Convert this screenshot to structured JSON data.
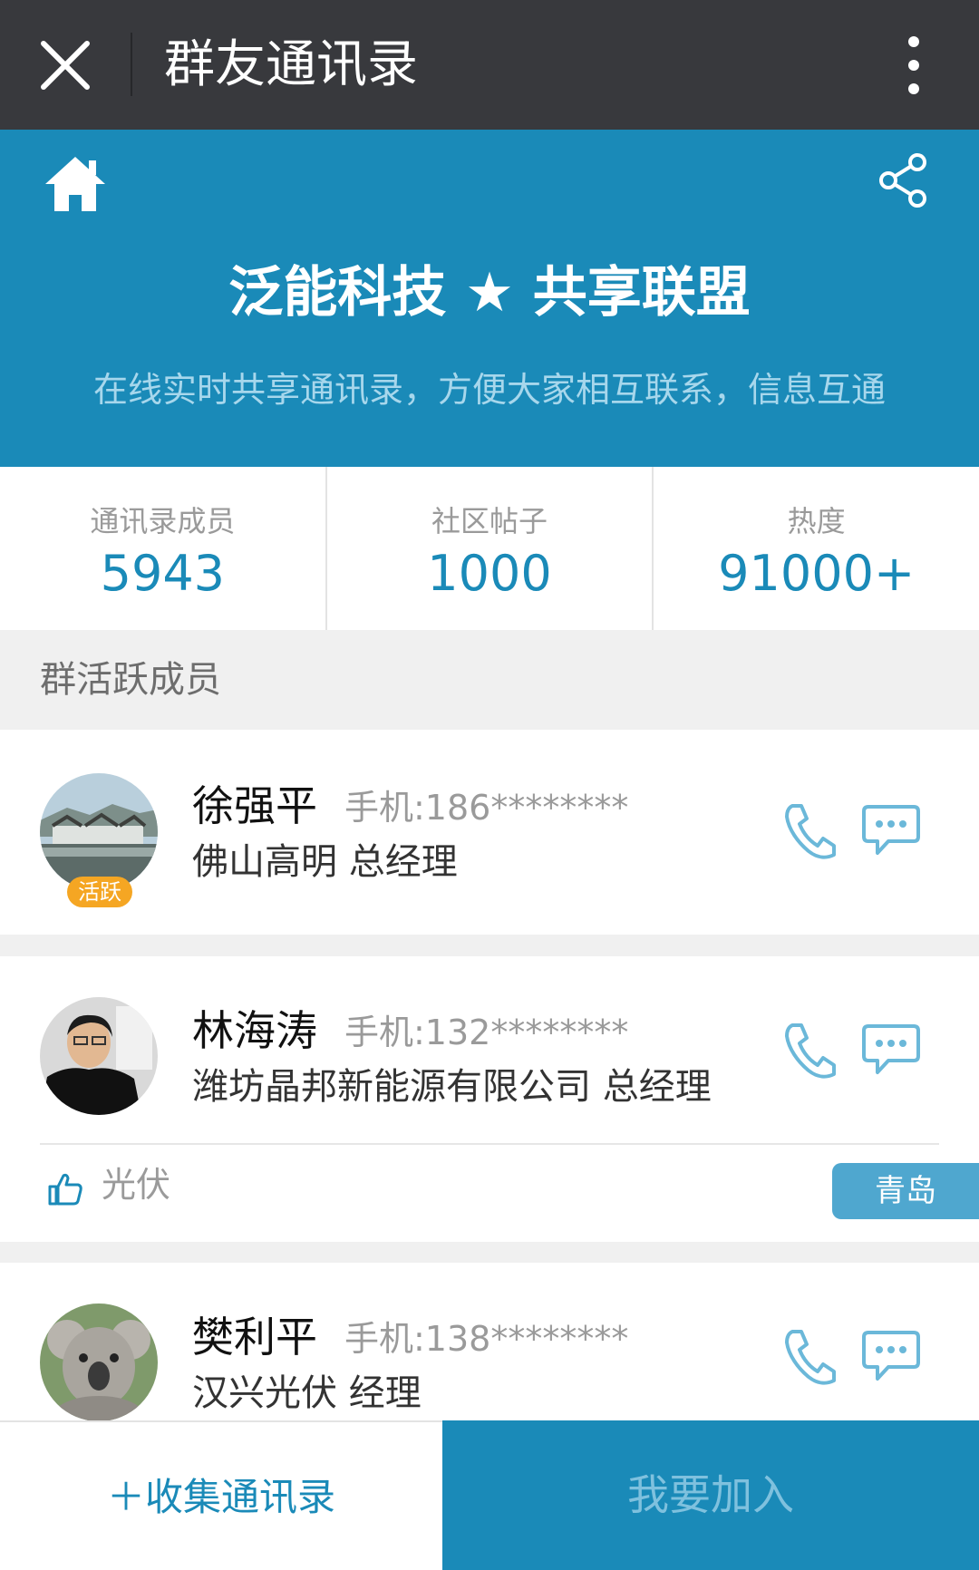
{
  "topbar": {
    "title": "群友通讯录"
  },
  "header": {
    "title": "泛能科技 ★ 共享联盟",
    "subtitle": "在线实时共享通讯录，方便大家相互联系，信息互通"
  },
  "stats": [
    {
      "label": "通讯录成员",
      "value": "5943"
    },
    {
      "label": "社区帖子",
      "value": "1000"
    },
    {
      "label": "热度",
      "value": "91000+"
    }
  ],
  "section": {
    "title": "群活跃成员"
  },
  "members": [
    {
      "name": "徐强平",
      "phone": "手机:186********",
      "company": "佛山高明 总经理",
      "badge": "活跃"
    },
    {
      "name": "林海涛",
      "phone": "手机:132********",
      "company": "潍坊晶邦新能源有限公司 总经理",
      "tag": "光伏",
      "city": "青岛"
    },
    {
      "name": "樊利平",
      "phone": "手机:138********",
      "company": "汉兴光伏 经理"
    }
  ],
  "bottombar": {
    "collect_label": "＋收集通讯录",
    "join_label": "我要加入"
  },
  "colors": {
    "brand": "#1a8ab8",
    "topbar": "#38393d",
    "badge": "#f5a623",
    "city_tag": "#4fa7cf"
  }
}
